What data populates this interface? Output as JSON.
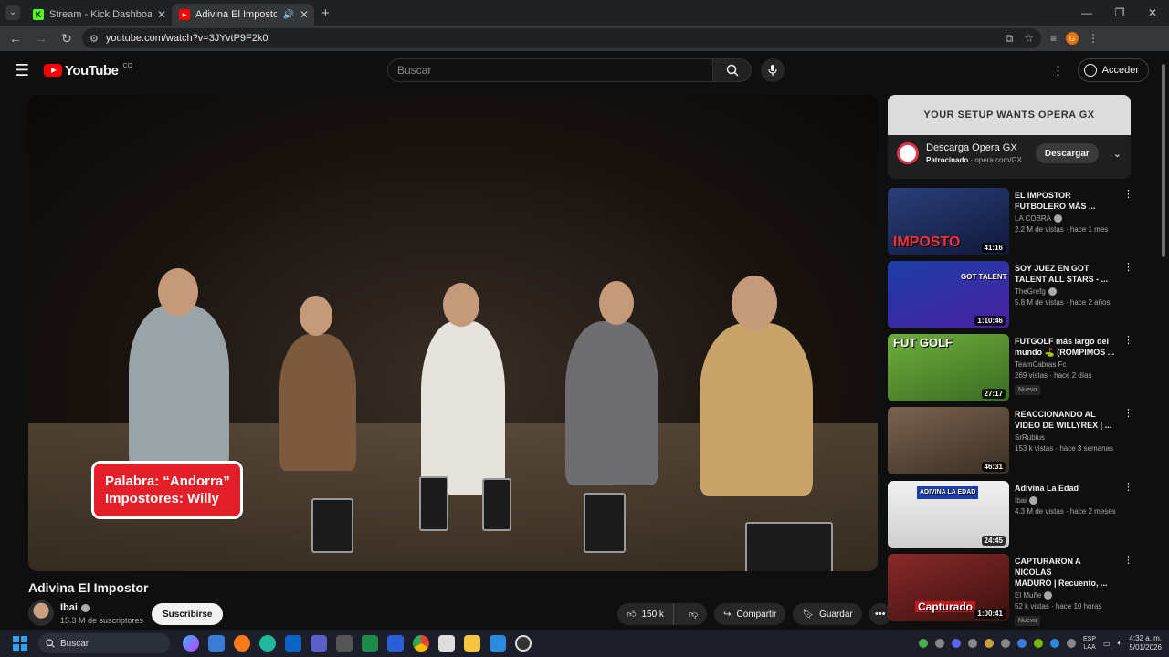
{
  "browser": {
    "tabs": [
      {
        "title": "Stream - Kick Dashboard",
        "favicon_color": "#53fc18",
        "favicon_letter": "K",
        "active": false
      },
      {
        "title": "Adivina El Impostor - YouTu",
        "favicon_color": "#ff0000",
        "favicon_letter": "▶",
        "active": true
      }
    ],
    "url": "youtube.com/watch?v=3JYvtP9F2k0"
  },
  "header": {
    "logo_text": "YouTube",
    "country_code": "CO",
    "search_placeholder": "Buscar",
    "signin_label": "Acceder"
  },
  "player": {
    "caption_line1": "Palabra: “Andorra”",
    "caption_line2": "Impostores: Willy"
  },
  "video": {
    "title": "Adivina El Impostor",
    "channel": "Ibai",
    "subscribers": "15.3 M de suscriptores",
    "subscribe_label": "Suscribirse",
    "likes": "150 k",
    "share_label": "Compartir",
    "save_label": "Guardar"
  },
  "ad": {
    "banner_text": "YOUR SETUP WANTS OPERA GX",
    "title": "Descarga Opera GX",
    "sponsored": "Patrocinado",
    "domain": "opera.com/GX",
    "button": "Descargar"
  },
  "recommendations": [
    {
      "title_line1": "EL IMPOSTOR",
      "title_line2": "FUTBOLERO MÁS ...",
      "channel": "LA COBRA",
      "verified": true,
      "meta": "2.2 M de vistas · hace 1 mes",
      "duration": "41:16",
      "thumb_text": "IMPOSTO",
      "thumb_color": "#2a3f7a",
      "is_new": false
    },
    {
      "title_line1": "SOY JUEZ EN GOT",
      "title_line2": "TALENT ALL STARS - ...",
      "channel": "TheGrefg",
      "verified": true,
      "meta": "5.8 M de vistas · hace 2 años",
      "duration": "1:10:46",
      "thumb_text": "GOT TALENT",
      "thumb_color": "#1c3fa8",
      "is_new": false
    },
    {
      "title_line1": "FUTGOLF más largo del",
      "title_line2": "mundo ⛳ (ROMPIMOS ...",
      "channel": "TeamCabras Fc",
      "verified": false,
      "meta": "269 vistas · hace 2 días",
      "duration": "27:17",
      "thumb_text": "FUT GOLF",
      "thumb_color": "#4f8a2a",
      "is_new": true
    },
    {
      "title_line1": "REACCIONANDO AL",
      "title_line2": "VIDEO DE WILLYREX | ...",
      "channel": "SrRubius",
      "verified": false,
      "meta": "153 k vistas · hace 3 semanas",
      "duration": "46:31",
      "thumb_text": "",
      "thumb_color": "#5a4636",
      "is_new": false
    },
    {
      "title_line1": "Adivina La Edad",
      "title_line2": "",
      "channel": "Ibai",
      "verified": true,
      "meta": "4.3 M de vistas · hace 2 meses",
      "duration": "24:45",
      "thumb_text": "ADIVINA LA EDAD",
      "thumb_color": "#d9d9d9",
      "is_new": false
    },
    {
      "title_line1": "CAPTURARON A NICOLAS",
      "title_line2": "MADURO | Recuento, ...",
      "channel": "El Muñe",
      "verified": true,
      "meta": "52 k vistas · hace 10 horas",
      "duration": "1:00:41",
      "thumb_text": "Capturado",
      "thumb_color": "#7a1f1f",
      "is_new": true
    }
  ],
  "new_badge": "Nuevo",
  "taskbar": {
    "search_label": "Buscar",
    "lang_line1": "ESP",
    "lang_line2": "LAA",
    "time": "4:32 a. m.",
    "date": "5/01/2026"
  }
}
